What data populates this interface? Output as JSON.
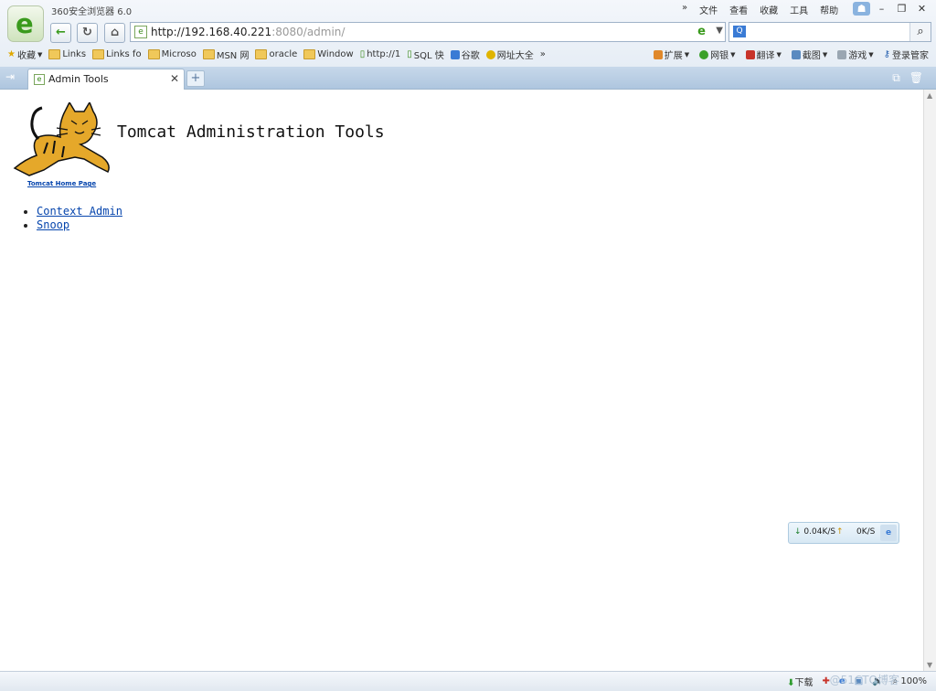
{
  "window": {
    "app_title": "360安全浏览器 6.0",
    "menu": [
      "文件",
      "查看",
      "收藏",
      "工具",
      "帮助"
    ]
  },
  "nav": {
    "url_host": "http://192.168.40.221",
    "url_rest": ":8080/admin/"
  },
  "bookmarks": [
    {
      "label": "收藏",
      "icon": "star-icon"
    },
    {
      "label": "Links",
      "icon": "folder-icon"
    },
    {
      "label": "Links fo",
      "icon": "folder-icon"
    },
    {
      "label": "Microso",
      "icon": "folder-icon"
    },
    {
      "label": "MSN 网",
      "icon": "folder-icon"
    },
    {
      "label": "oracle",
      "icon": "folder-icon"
    },
    {
      "label": "Window",
      "icon": "folder-icon"
    },
    {
      "label": "http://1",
      "icon": "page-icon"
    },
    {
      "label": "SQL 快",
      "icon": "page-icon"
    },
    {
      "label": "谷歌",
      "icon": "google-icon"
    },
    {
      "label": "网址大全",
      "icon": "globe-icon"
    }
  ],
  "tools": [
    "扩展",
    "网银",
    "翻译",
    "截图",
    "游戏",
    "登录管家"
  ],
  "tab": {
    "title": "Admin Tools"
  },
  "page": {
    "home_link": "Tomcat Home Page",
    "title": "Tomcat Administration Tools",
    "links": [
      "Context Admin",
      "Snoop"
    ]
  },
  "speed": {
    "down": "0.04K/S",
    "up": "0K/S"
  },
  "status": {
    "download": "下载",
    "zoom": "100%",
    "watermark": "@51CTO博客"
  }
}
